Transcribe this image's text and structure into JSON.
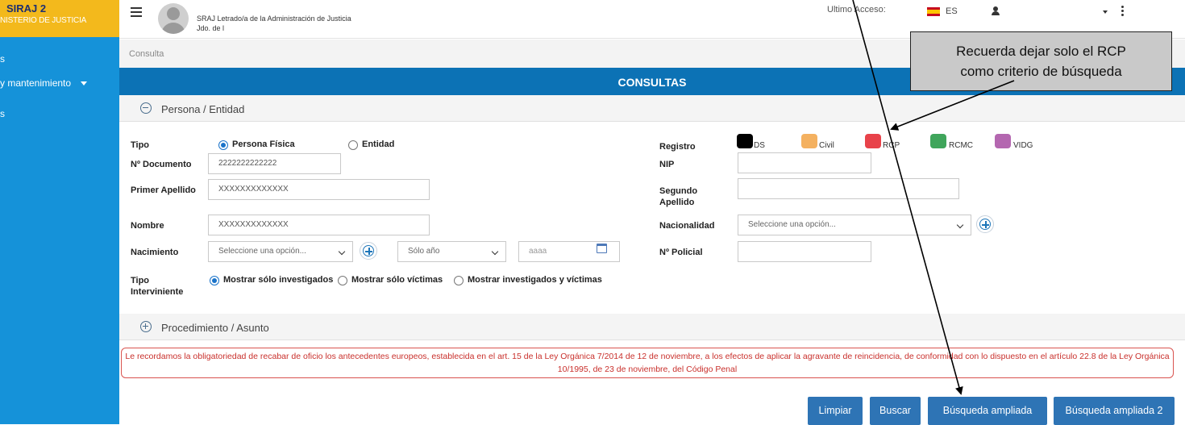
{
  "sidebar": {
    "brand_title": "SIRAJ 2",
    "brand_subtitle": "NISTERIO DE JUSTICIA",
    "items": [
      {
        "label": "s"
      },
      {
        "label": "y mantenimiento"
      },
      {
        "label": "s"
      }
    ]
  },
  "topbar": {
    "user_role": "SRAJ Letrado/a de la Administración de Justicia",
    "user_court": "Jdo. de l",
    "last_access_label": "Ultimo Acceso:",
    "language": "ES"
  },
  "breadcrumb": "Consulta",
  "page_title": "CONSULTAS",
  "sections": {
    "persona": "Persona / Entidad",
    "procedimiento": "Procedimiento / Asunto"
  },
  "form": {
    "tipo_label": "Tipo",
    "tipo_options": [
      "Persona Física",
      "Entidad"
    ],
    "tipo_selected": "Persona Física",
    "documento_label": "Nº Documento",
    "documento_value": "2222222222222",
    "primer_apellido_label": "Primer Apellido",
    "primer_apellido_value": "XXXXXXXXXXXXX",
    "nombre_label": "Nombre",
    "nombre_value": "XXXXXXXXXXXXX",
    "nacimiento_label": "Nacimiento",
    "nacimiento_select": "Seleccione una opción...",
    "year_mode_select": "Sólo año",
    "year_placeholder": "aaaa",
    "tipo_interviniente_label_1": "Tipo",
    "tipo_interviniente_label_2": "Interviniente",
    "interviniente_options": [
      "Mostrar sólo investigados",
      "Mostrar sólo víctimas",
      "Mostrar investigados y víctimas"
    ],
    "registro_label": "Registro",
    "registros": [
      {
        "label": "DS",
        "color": "#000000"
      },
      {
        "label": "Civil",
        "color": "#f4b160"
      },
      {
        "label": "RCP",
        "color": "#e8424a"
      },
      {
        "label": "RCMC",
        "color": "#3fa55b"
      },
      {
        "label": "VIDG",
        "color": "#b467b0"
      }
    ],
    "nip_label": "NIP",
    "segundo_apellido_label_1": "Segundo",
    "segundo_apellido_label_2": "Apellido",
    "nacionalidad_label": "Nacionalidad",
    "nacionalidad_select": "Seleccione una opción...",
    "policial_label": "Nº Policial"
  },
  "notice": "Le recordamos la obligatoriedad de recabar de oficio los antecedentes europeos, establecida en el art. 15 de la Ley Orgánica 7/2014 de 12 de noviembre, a los efectos de aplicar la agravante de reincidencia, de conformidad con lo dispuesto en el artículo 22.8 de la Ley Orgánica 10/1995, de 23 de noviembre, del Código Penal",
  "buttons": {
    "limpiar": "Limpiar",
    "buscar": "Buscar",
    "ampliada": "Búsqueda ampliada",
    "ampliada2": "Búsqueda ampliada 2"
  },
  "annotation": {
    "line1": "Recuerda dejar solo el RCP",
    "line2": "como criterio de búsqueda"
  },
  "colors": {
    "sidebar": "#1592d9",
    "brand": "#f3b91c",
    "header_band": "#0c72b5",
    "button": "#2e74b5",
    "notice": "#c9302c"
  }
}
